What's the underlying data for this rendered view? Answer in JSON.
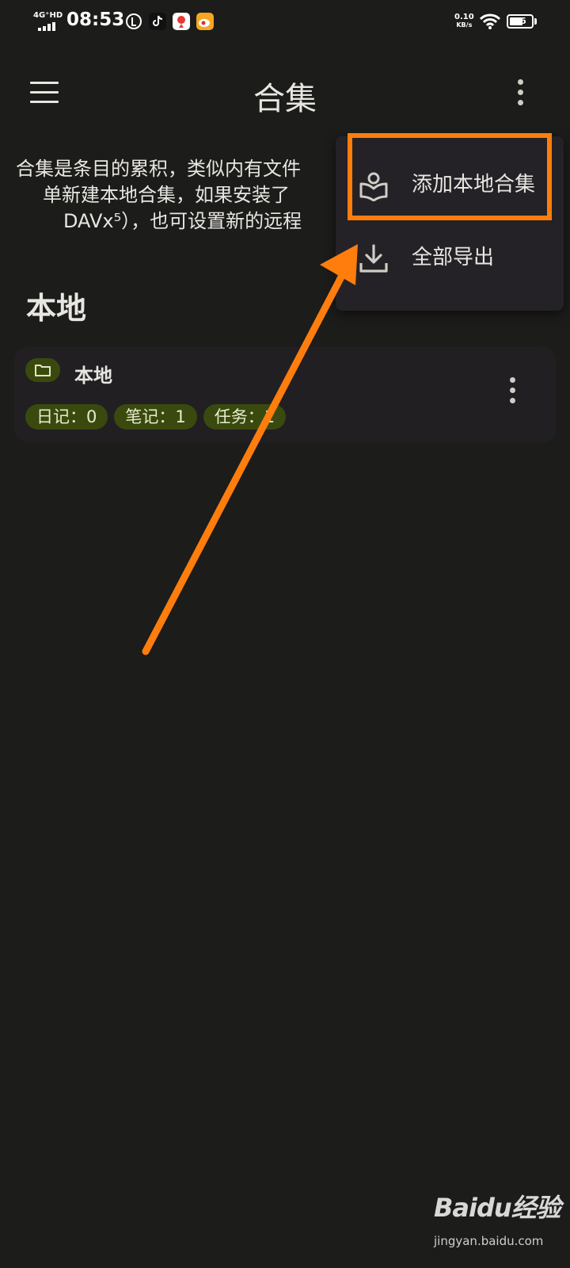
{
  "status_bar": {
    "network": "4G⁺HD",
    "time": "08:53",
    "speed_value": "0.10",
    "speed_unit": "KB/s",
    "battery": "56"
  },
  "app_bar": {
    "title": "合集",
    "menu_icon": "hamburger-icon",
    "more_icon": "more-vert-icon"
  },
  "description": {
    "lines": [
      "合集是条目的累积，类似内有文件",
      "单新建本地合集，如果安装了",
      "DAVx⁵），也可设置新的远程"
    ]
  },
  "section": {
    "title": "本地",
    "card": {
      "icon": "folder-icon",
      "title": "本地",
      "chips": [
        "日记：0",
        "笔记：1",
        "任务：1"
      ]
    }
  },
  "dropdown_menu": {
    "items": [
      {
        "label": "添加本地合集",
        "icon": "local-library-icon"
      },
      {
        "label": "全部导出",
        "icon": "download-icon"
      }
    ]
  },
  "annotation": {
    "color": "#ff7d0d"
  },
  "watermark": {
    "brand": "Baidu经验",
    "site": "jingyan.baidu.com"
  }
}
